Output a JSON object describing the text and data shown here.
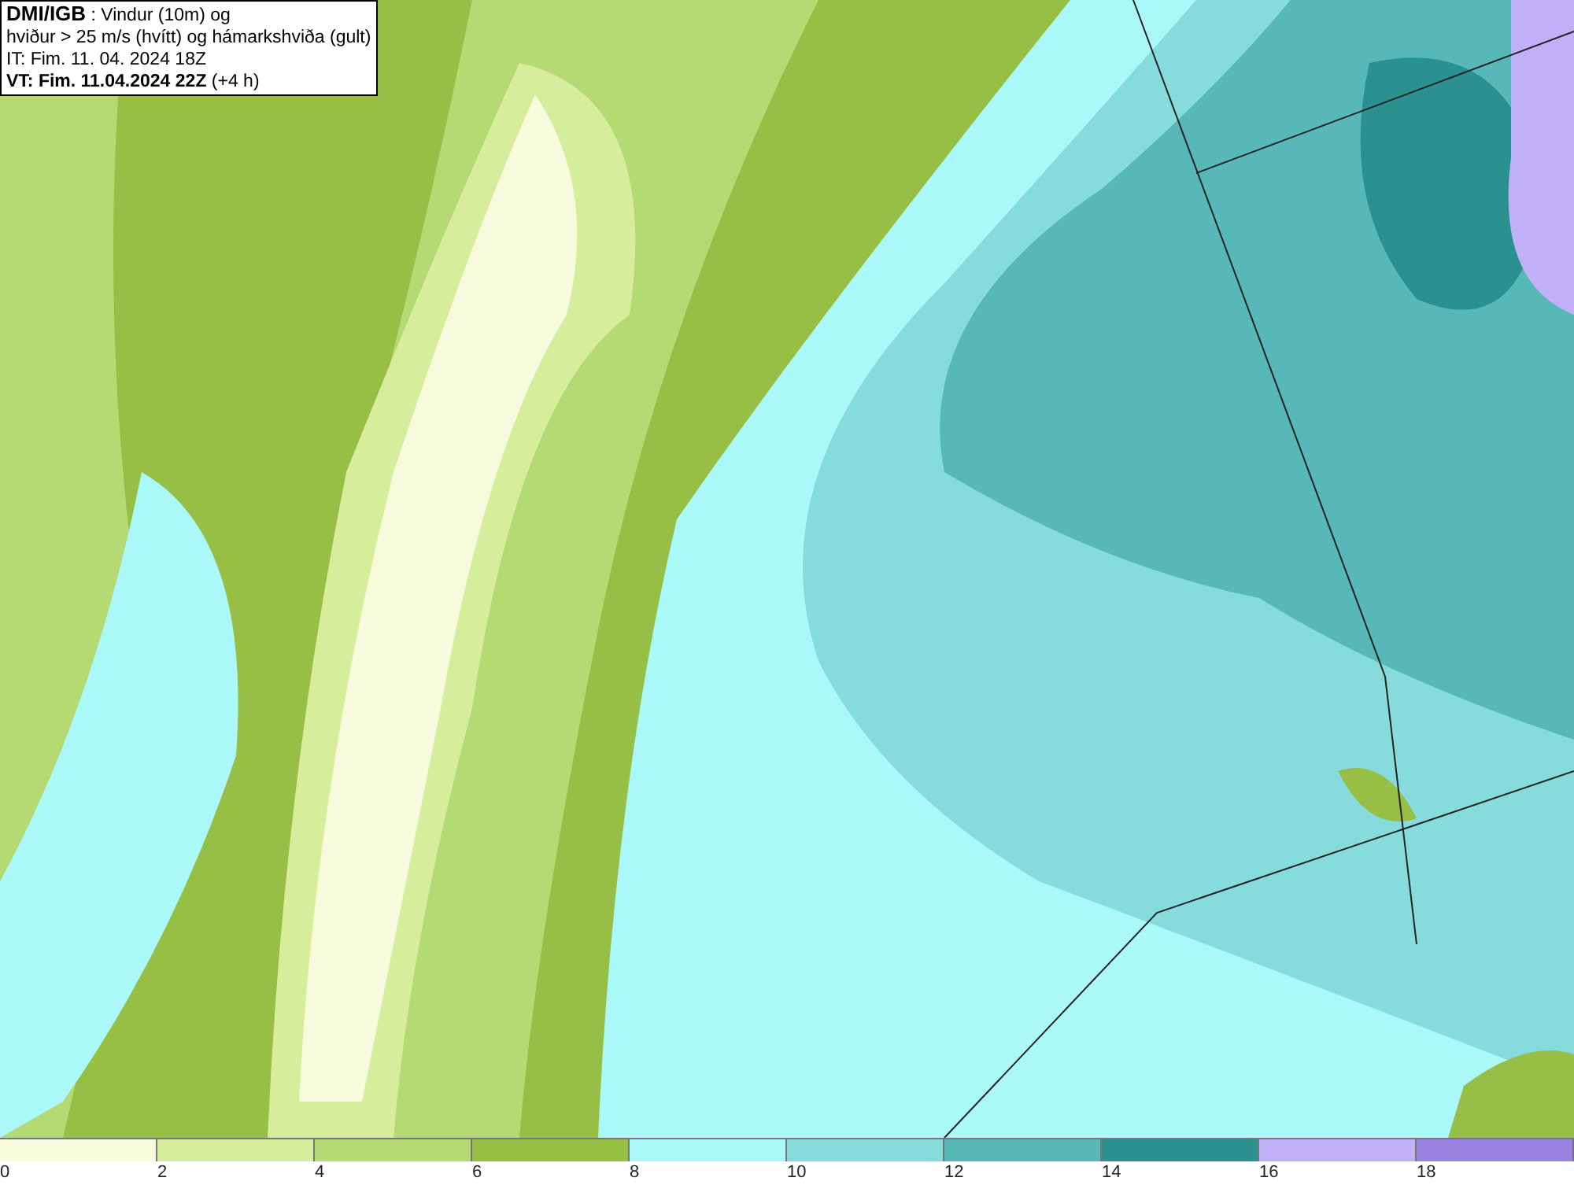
{
  "title_box": {
    "lines": [
      "**DMI/IGB** : Vindur (10m) og",
      "hviður > 25 m/s (hvítt) og hámarkshviða (gult)",
      "IT: Fim. 11. 04. 2024 18Z",
      "**VT: Fim. 11.04.2024 22Z** (+4 h)"
    ]
  },
  "legend": {
    "items": [
      {
        "label": "0",
        "color": "#f5fbdc"
      },
      {
        "label": "2",
        "color": "#d6ee9c"
      },
      {
        "label": "4",
        "color": "#b5d973"
      },
      {
        "label": "6",
        "color": "#98bf45"
      },
      {
        "label": "8",
        "color": "#aaf8f8"
      },
      {
        "label": "10",
        "color": "#86dcdc"
      },
      {
        "label": "12",
        "color": "#58b8b8"
      },
      {
        "label": "14",
        "color": "#2a9090"
      },
      {
        "label": "16",
        "color": "#c0b0f8"
      },
      {
        "label": "18",
        "color": "#9a82e0"
      }
    ]
  }
}
